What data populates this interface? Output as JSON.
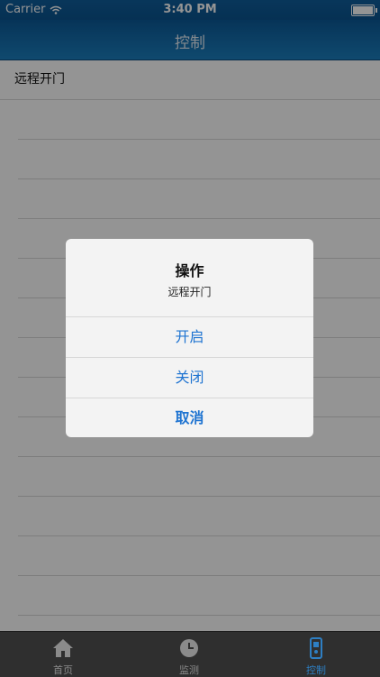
{
  "status": {
    "carrier": "Carrier",
    "time": "3:40 PM"
  },
  "nav": {
    "title": "控制"
  },
  "list": {
    "first_item": "远程开门"
  },
  "dialog": {
    "title": "操作",
    "message": "远程开门",
    "buttons": {
      "open": "开启",
      "close": "关闭",
      "cancel": "取消"
    }
  },
  "tabs": {
    "home": "首页",
    "monitor": "监测",
    "control": "控制"
  },
  "colors": {
    "accent": "#1f74d1",
    "nav": "#0c5a98",
    "tab_active": "#2e7fc3",
    "tab_inactive": "#8b8b8b"
  }
}
